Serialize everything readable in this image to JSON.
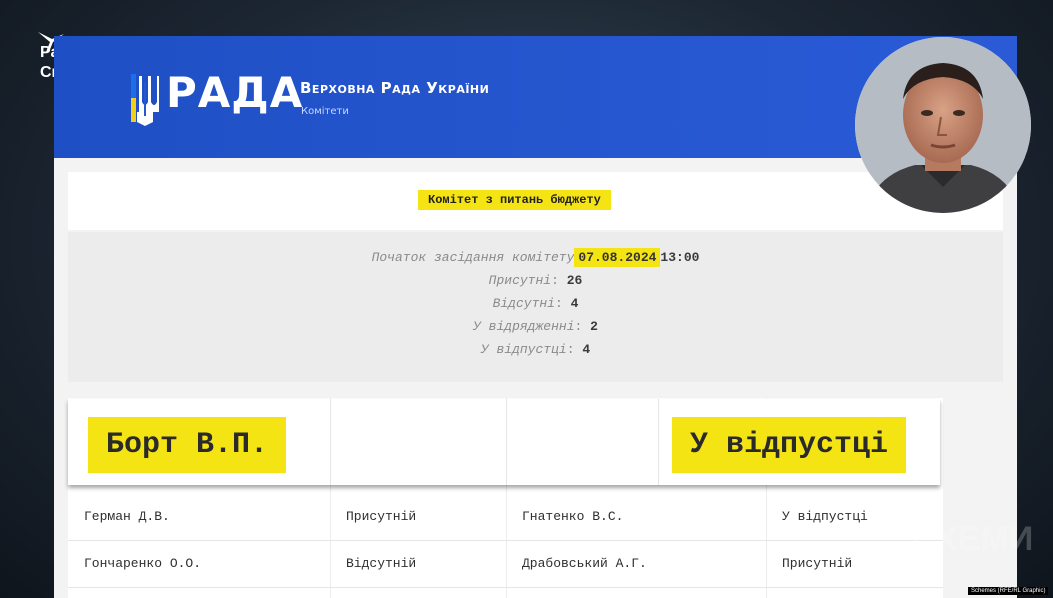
{
  "brand": {
    "radio_name_line1": "Радіо",
    "radio_name_line2": "Свобода",
    "watermark": "СХЕМИ",
    "credit": "Schemes (RFE/RL Graphic)"
  },
  "header": {
    "rada_word": "РАДА",
    "title": "Верховна Рада України",
    "subtitle": "Комітети"
  },
  "committee": {
    "name": "Комітет з питань бюджету"
  },
  "session": {
    "start_label": "Початок засідання комітету",
    "date": "07.08.2024",
    "time": "13:00",
    "stats": [
      {
        "label": "Присутні",
        "value": "26"
      },
      {
        "label": "Відсутні",
        "value": "4"
      },
      {
        "label": "У відрядженні",
        "value": "2"
      },
      {
        "label": "У відпустці",
        "value": "4"
      }
    ]
  },
  "highlight_row": {
    "name": "Борт В.П.",
    "status": "У відпустці"
  },
  "table": {
    "rows": [
      {
        "name1": "Герман Д.В.",
        "status1": "Присутній",
        "name2": "Гнатенко В.С.",
        "status2": "У відпустці"
      },
      {
        "name1": "Гончаренко О.О.",
        "status1": "Відсутній",
        "name2": "Драбовський А.Г.",
        "status2": "Присутній"
      }
    ]
  },
  "colors": {
    "header_blue": "#2657d0",
    "highlight_yellow": "#f5e414"
  }
}
